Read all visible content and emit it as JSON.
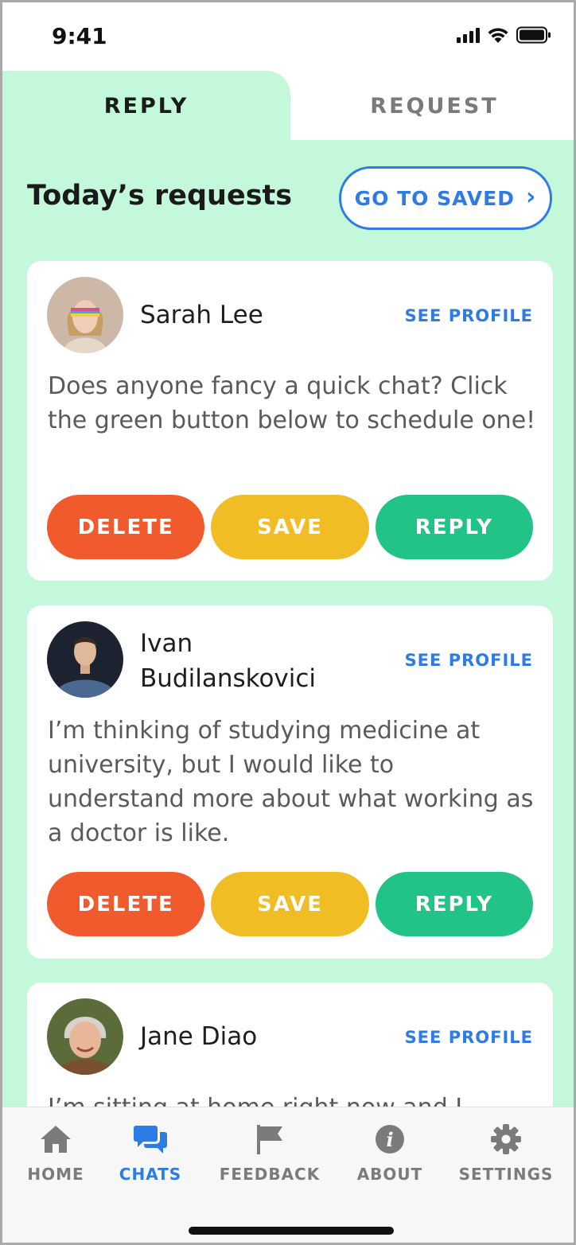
{
  "status_bar": {
    "time": "9:41"
  },
  "tabs": [
    {
      "label": "REPLY",
      "active": true
    },
    {
      "label": "REQUEST",
      "active": false
    }
  ],
  "main": {
    "title": "Today’s requests",
    "go_to_saved": "GO TO SAVED",
    "cards": [
      {
        "name": "Sarah Lee",
        "see_profile": "SEE PROFILE",
        "message": "Does anyone fancy a quick chat? Click the green button below to schedule one!",
        "actions": {
          "delete": "DELETE",
          "save": "SAVE",
          "reply": "REPLY"
        }
      },
      {
        "name_line1": "Ivan",
        "name_line2": "Budilanskovici",
        "see_profile": "SEE PROFILE",
        "message": "I’m thinking of studying medicine at university, but I would like to understand more about what working as a doctor is like.",
        "actions": {
          "delete": "DELETE",
          "save": "SAVE",
          "reply": "REPLY"
        }
      },
      {
        "name": "Jane Diao",
        "see_profile": "SEE PROFILE",
        "message": "I’m sitting at home right now and I"
      }
    ]
  },
  "bottom_nav": [
    {
      "label": "HOME",
      "icon": "home-icon",
      "active": false
    },
    {
      "label": "CHATS",
      "icon": "chat-icon",
      "active": true
    },
    {
      "label": "FEEDBACK",
      "icon": "flag-icon",
      "active": false
    },
    {
      "label": "ABOUT",
      "icon": "info-icon",
      "active": false
    },
    {
      "label": "SETTINGS",
      "icon": "gear-icon",
      "active": false
    }
  ],
  "colors": {
    "accent_blue": "#2d7be5",
    "mint_background": "#c4f8da",
    "delete_orange": "#f05a2c",
    "save_yellow": "#f0bd24",
    "reply_green": "#22c388"
  }
}
